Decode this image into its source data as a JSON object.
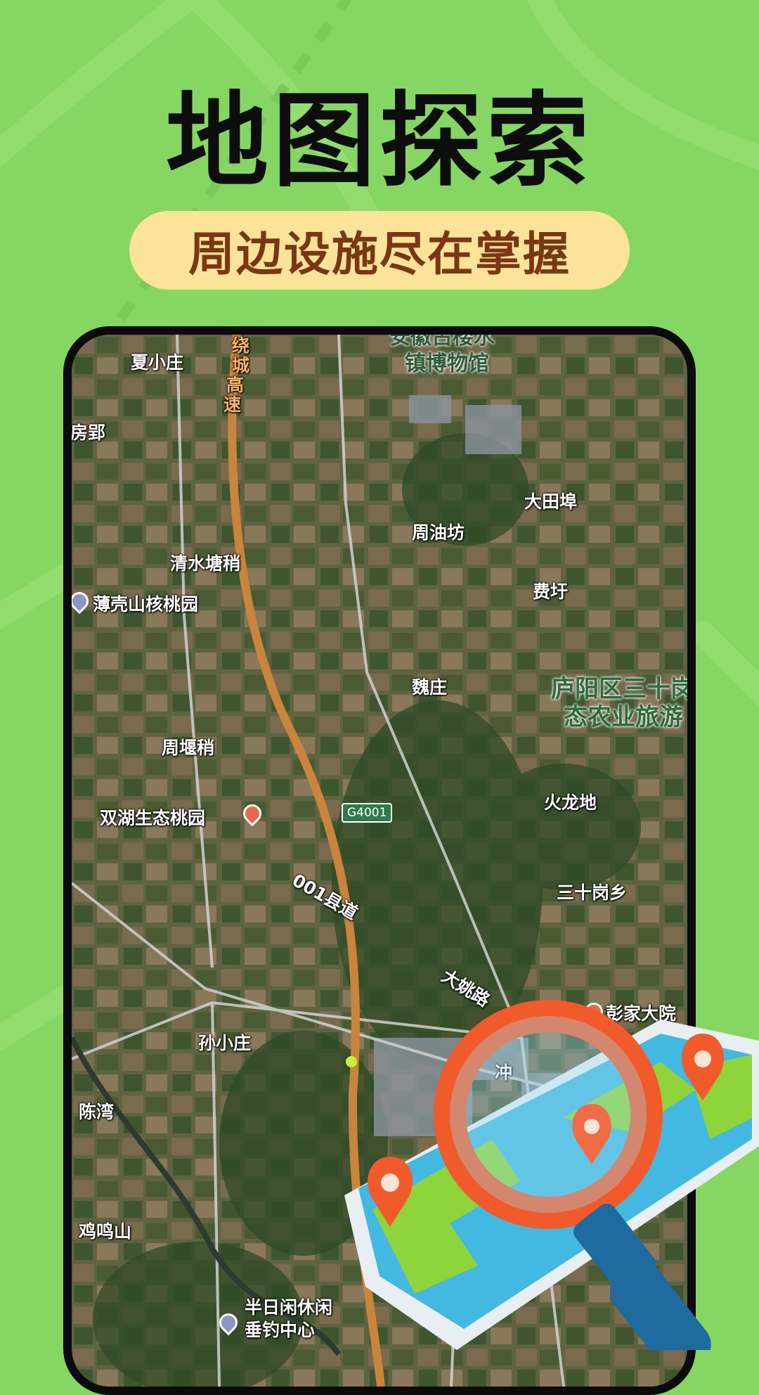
{
  "headline": "地图探索",
  "tagline": "周边设施尽在掌握",
  "map": {
    "labels": {
      "xia_xiao_zhuang": "夏小庄",
      "ring_expressway_1": "绕",
      "ring_expressway_2": "城",
      "ring_expressway_3": "高",
      "ring_expressway_4": "速",
      "museum_1": "安徽古楼水",
      "museum_2": "镇博物馆",
      "fang_ying": "房郢",
      "da_tian_bu": "大田埠",
      "zhou_you_fang": "周油坊",
      "qing_shui_tang_shao": "清水塘稍",
      "bo_ke_shan": "薄壳山核桃园",
      "fei_yu": "费圩",
      "wei_zhuang": "魏庄",
      "luyang_1": "庐阳区三十岗",
      "luyang_2": "态农业旅游",
      "zhou_yan_shao": "周堰稍",
      "shuang_hu": "双湖生态桃园",
      "g4001": "G4001",
      "huo_long_di": "火龙地",
      "county_road": "001县道",
      "san_shi_gang": "三十岗乡",
      "da_yao_road": "大姚路",
      "peng_jia": "彭家大院",
      "sun_xiao_zhuang": "孙小庄",
      "chong": "冲",
      "chen_wan": "陈湾",
      "ji_ming_shan": "鸡鸣山",
      "fishing_1": "半日闲休闲",
      "fishing_2": "垂钓中心"
    }
  },
  "colors": {
    "background": "#86d663",
    "pill": "#fbe49a",
    "tagline_text": "#7a3714",
    "expressway": "#c9853b"
  },
  "icons": [
    "location-pin-icon",
    "scenic-spot-icon",
    "magnifier-map-illustration"
  ]
}
